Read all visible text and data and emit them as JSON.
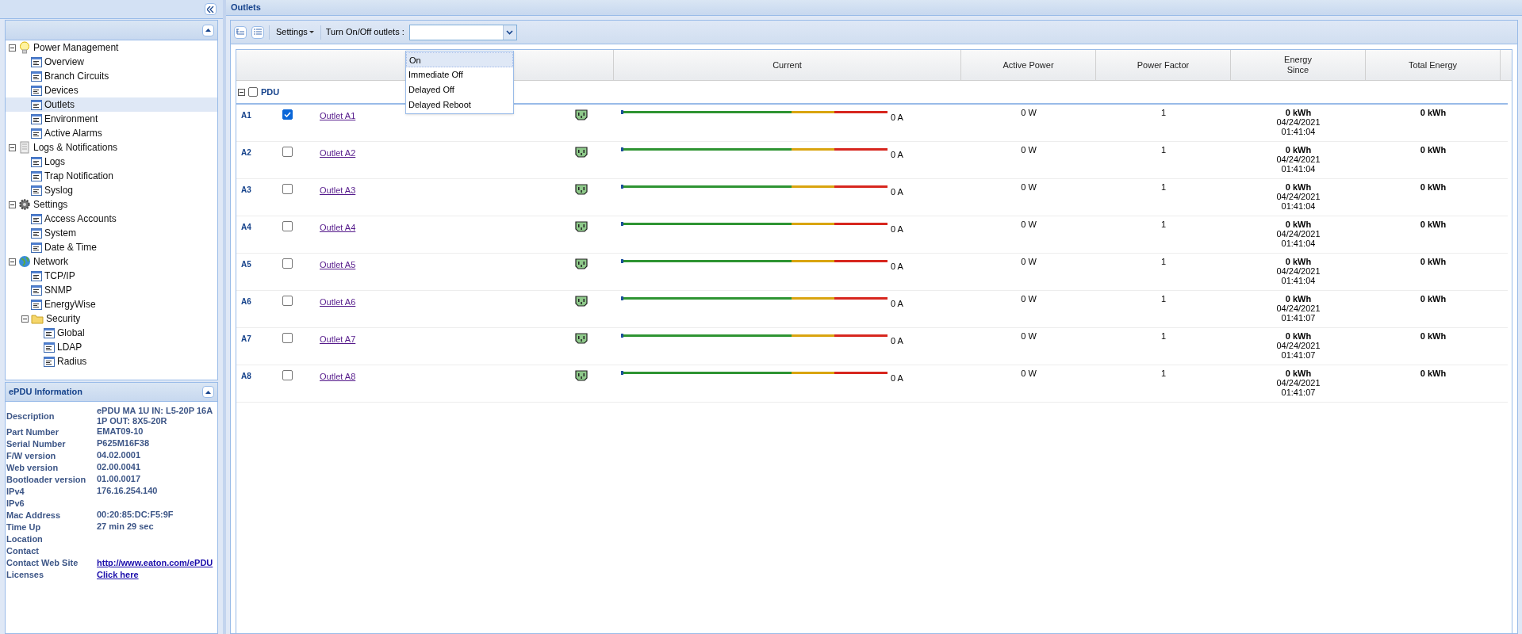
{
  "sidebar": {
    "tree": [
      {
        "label": "Power Management",
        "kind": "bulb",
        "expanded": true,
        "children": [
          {
            "label": "Overview",
            "selected": false
          },
          {
            "label": "Branch Circuits",
            "selected": false
          },
          {
            "label": "Devices",
            "selected": false
          },
          {
            "label": "Outlets",
            "selected": true
          },
          {
            "label": "Environment",
            "selected": false
          },
          {
            "label": "Active Alarms",
            "selected": false
          }
        ]
      },
      {
        "label": "Logs & Notifications",
        "kind": "document",
        "expanded": true,
        "children": [
          {
            "label": "Logs",
            "selected": false
          },
          {
            "label": "Trap Notification",
            "selected": false
          },
          {
            "label": "Syslog",
            "selected": false
          }
        ]
      },
      {
        "label": "Settings",
        "kind": "gear",
        "expanded": true,
        "children": [
          {
            "label": "Access Accounts",
            "selected": false
          },
          {
            "label": "System",
            "selected": false
          },
          {
            "label": "Date & Time",
            "selected": false
          }
        ]
      },
      {
        "label": "Network",
        "kind": "globe",
        "expanded": true,
        "children": [
          {
            "label": "TCP/IP",
            "selected": false
          },
          {
            "label": "SNMP",
            "selected": false
          },
          {
            "label": "EnergyWise",
            "selected": false
          },
          {
            "label": "Security",
            "kind": "folder",
            "expanded": true,
            "selected": false,
            "children": [
              {
                "label": "Global",
                "selected": false
              },
              {
                "label": "LDAP",
                "selected": false
              },
              {
                "label": "Radius",
                "selected": false
              }
            ]
          }
        ]
      }
    ]
  },
  "info_panel": {
    "title": "ePDU Information",
    "rows": [
      {
        "label": "Description",
        "value": "ePDU MA 1U IN: L5-20P 16A 1P OUT: 8X5-20R"
      },
      {
        "label": "Part Number",
        "value": "EMAT09-10"
      },
      {
        "label": "Serial Number",
        "value": "P625M16F38"
      },
      {
        "label": "F/W version",
        "value": "04.02.0001"
      },
      {
        "label": "Web version",
        "value": "02.00.0041"
      },
      {
        "label": "Bootloader version",
        "value": "01.00.0017"
      },
      {
        "label": "IPv4",
        "value": "176.16.254.140"
      },
      {
        "label": "IPv6"
      },
      {
        "label": "Mac Address",
        "value": "00:20:85:DC:F5:9F"
      },
      {
        "label": "Time Up",
        "value": "27 min 29 sec"
      },
      {
        "label": "Location"
      },
      {
        "label": "Contact"
      },
      {
        "label": "Contact Web Site",
        "value": "http://www.eaton.com/ePDU",
        "kind": "link"
      },
      {
        "label": "Licenses",
        "value": "Click here",
        "kind": "link"
      }
    ]
  },
  "main": {
    "title": "Outlets",
    "toolbar": {
      "settings": "Settings",
      "turn_label": "Turn On/Off outlets :",
      "dropdown_options": [
        {
          "label": "On",
          "selected": true
        },
        {
          "label": "Immediate Off",
          "selected": false
        },
        {
          "label": "Delayed Off",
          "selected": false
        },
        {
          "label": "Delayed Reboot",
          "selected": false
        }
      ]
    },
    "columns": [
      "Current",
      "Active Power",
      "Power Factor",
      "Energy\nSince",
      "Total Energy"
    ],
    "group": {
      "label": "PDU",
      "checked": false,
      "expanded": true
    },
    "rows": [
      {
        "id": "A1",
        "checked": true,
        "name": "Outlet A1",
        "level": 0,
        "current": "0 A",
        "active_power": "0 W",
        "power_factor": "1",
        "energy": "0 kWh",
        "since_date": "04/24/2021",
        "since_time": "01:41:04",
        "total": "0 kWh"
      },
      {
        "id": "A2",
        "checked": false,
        "name": "Outlet A2",
        "level": 0,
        "current": "0 A",
        "active_power": "0 W",
        "power_factor": "1",
        "energy": "0 kWh",
        "since_date": "04/24/2021",
        "since_time": "01:41:04",
        "total": "0 kWh"
      },
      {
        "id": "A3",
        "checked": false,
        "name": "Outlet A3",
        "level": 0,
        "current": "0 A",
        "active_power": "0 W",
        "power_factor": "1",
        "energy": "0 kWh",
        "since_date": "04/24/2021",
        "since_time": "01:41:04",
        "total": "0 kWh"
      },
      {
        "id": "A4",
        "checked": false,
        "name": "Outlet A4",
        "level": 0,
        "current": "0 A",
        "active_power": "0 W",
        "power_factor": "1",
        "energy": "0 kWh",
        "since_date": "04/24/2021",
        "since_time": "01:41:04",
        "total": "0 kWh"
      },
      {
        "id": "A5",
        "checked": false,
        "name": "Outlet A5",
        "level": 0,
        "current": "0 A",
        "active_power": "0 W",
        "power_factor": "1",
        "energy": "0 kWh",
        "since_date": "04/24/2021",
        "since_time": "01:41:04",
        "total": "0 kWh"
      },
      {
        "id": "A6",
        "checked": false,
        "name": "Outlet A6",
        "level": 0,
        "current": "0 A",
        "active_power": "0 W",
        "power_factor": "1",
        "energy": "0 kWh",
        "since_date": "04/24/2021",
        "since_time": "01:41:07",
        "total": "0 kWh"
      },
      {
        "id": "A7",
        "checked": false,
        "name": "Outlet A7",
        "level": 0,
        "current": "0 A",
        "active_power": "0 W",
        "power_factor": "1",
        "energy": "0 kWh",
        "since_date": "04/24/2021",
        "since_time": "01:41:07",
        "total": "0 kWh"
      },
      {
        "id": "A8",
        "checked": false,
        "name": "Outlet A8",
        "level": 0,
        "current": "0 A",
        "active_power": "0 W",
        "power_factor": "1",
        "energy": "0 kWh",
        "since_date": "04/24/2021",
        "since_time": "01:41:07",
        "total": "0 kWh"
      }
    ]
  }
}
